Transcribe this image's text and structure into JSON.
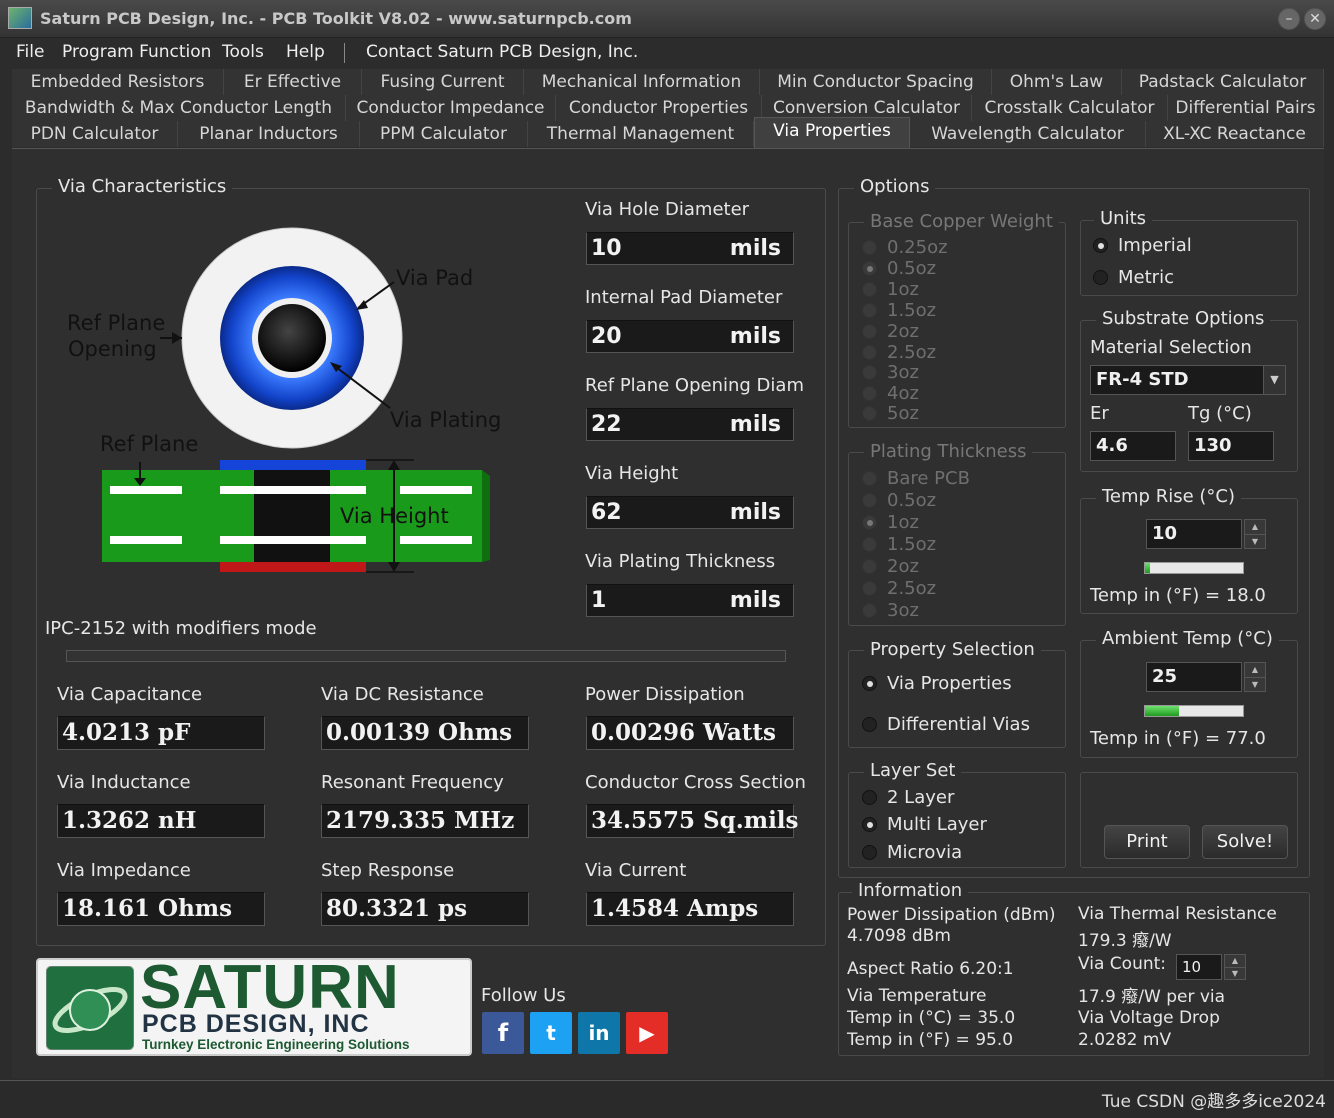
{
  "window": {
    "title": "Saturn PCB Design, Inc. - PCB Toolkit V8.02 - www.saturnpcb.com"
  },
  "menu": {
    "file": "File",
    "program_function": "Program Function",
    "tools": "Tools",
    "help": "Help",
    "contact": "Contact Saturn PCB Design, Inc."
  },
  "tabs": {
    "row1": [
      "Embedded Resistors",
      "Er Effective",
      "Fusing Current",
      "Mechanical Information",
      "Min Conductor Spacing",
      "Ohm's Law",
      "Padstack Calculator"
    ],
    "row2": [
      "Bandwidth & Max Conductor Length",
      "Conductor Impedance",
      "Conductor Properties",
      "Conversion Calculator",
      "Crosstalk Calculator",
      "Differential Pairs"
    ],
    "row3": [
      "PDN Calculator",
      "Planar Inductors",
      "PPM Calculator",
      "Thermal Management",
      "Via Properties",
      "Wavelength Calculator",
      "XL-XC Reactance"
    ],
    "active": "Via Properties"
  },
  "via_characteristics": {
    "title": "Via Characteristics",
    "diagram": {
      "via_pad": "Via Pad",
      "ref_plane_opening_1": "Ref Plane",
      "ref_plane_opening_2": "Opening",
      "via_plating": "Via Plating",
      "ref_plane": "Ref Plane",
      "via_height": "Via Height"
    },
    "inputs": {
      "hole_diameter": {
        "label": "Via Hole Diameter",
        "value": "10",
        "unit": "mils"
      },
      "internal_pad": {
        "label": "Internal Pad Diameter",
        "value": "20",
        "unit": "mils"
      },
      "ref_plane_opening": {
        "label": "Ref Plane Opening Diam",
        "value": "22",
        "unit": "mils"
      },
      "via_height": {
        "label": "Via Height",
        "value": "62",
        "unit": "mils"
      },
      "plating_thickness": {
        "label": "Via Plating Thickness",
        "value": "1",
        "unit": "mils"
      }
    },
    "mode": "IPC-2152 with modifiers mode",
    "results": {
      "capacitance": {
        "label": "Via Capacitance",
        "value": "4.0213 pF"
      },
      "dc_resistance": {
        "label": "Via DC Resistance",
        "value": "0.00139 Ohms"
      },
      "power_dissipation": {
        "label": "Power Dissipation",
        "value": "0.00296 Watts"
      },
      "inductance": {
        "label": "Via Inductance",
        "value": "1.3262 nH"
      },
      "resonant_frequency": {
        "label": "Resonant Frequency",
        "value": "2179.335 MHz"
      },
      "cross_section": {
        "label": "Conductor Cross Section",
        "value": "34.5575 Sq.mils"
      },
      "impedance": {
        "label": "Via Impedance",
        "value": "18.161 Ohms"
      },
      "step_response": {
        "label": "Step Response",
        "value": "80.3321 ps"
      },
      "via_current": {
        "label": "Via Current",
        "value": "1.4584 Amps"
      }
    }
  },
  "options": {
    "title": "Options",
    "base_copper": {
      "title": "Base Copper Weight",
      "items": [
        "0.25oz",
        "0.5oz",
        "1oz",
        "1.5oz",
        "2oz",
        "2.5oz",
        "3oz",
        "4oz",
        "5oz"
      ],
      "selected": "0.5oz"
    },
    "plating": {
      "title": "Plating Thickness",
      "items": [
        "Bare PCB",
        "0.5oz",
        "1oz",
        "1.5oz",
        "2oz",
        "2.5oz",
        "3oz"
      ],
      "selected": "1oz"
    },
    "units": {
      "title": "Units",
      "imperial": "Imperial",
      "metric": "Metric",
      "selected": "Imperial"
    },
    "substrate": {
      "title": "Substrate Options",
      "material_label": "Material Selection",
      "material": "FR-4 STD",
      "er_label": "Er",
      "er": "4.6",
      "tg_label": "Tg (°C)",
      "tg": "130"
    },
    "temp_rise": {
      "title": "Temp Rise (°C)",
      "value": "10",
      "level": 0.05,
      "readout": "Temp in (°F) = 18.0"
    },
    "ambient": {
      "title": "Ambient Temp (°C)",
      "value": "25",
      "level": 0.35,
      "readout": "Temp in (°F) = 77.0"
    },
    "property_selection": {
      "title": "Property Selection",
      "via_properties": "Via Properties",
      "differential_vias": "Differential Vias",
      "selected": "Via Properties"
    },
    "layer_set": {
      "title": "Layer Set",
      "items": [
        "2 Layer",
        "Multi Layer",
        "Microvia"
      ],
      "selected": "Multi Layer"
    },
    "print": "Print",
    "solve": "Solve!"
  },
  "information": {
    "title": "Information",
    "power_dissipation_label": "Power Dissipation (dBm)",
    "power_dissipation_value": "4.7098 dBm",
    "aspect_ratio": "Aspect Ratio   6.20:1",
    "via_temperature": "Via Temperature",
    "temp_c": "Temp in (°C) = 35.0",
    "temp_f": "Temp in (°F) = 95.0",
    "thermal_resistance_label": "Via Thermal Resistance",
    "thermal_resistance_value": "179.3 癈/W",
    "via_count_label": "Via Count:",
    "via_count": "10",
    "per_via": "17.9 癈/W per via",
    "voltage_drop_label": "Via Voltage Drop",
    "voltage_drop_value": "2.0282 mV"
  },
  "footer": {
    "logo_line1": "SATURN",
    "logo_line2": "PCB DESIGN, INC",
    "logo_tagline": "Turnkey Electronic Engineering Solutions",
    "follow_us": "Follow Us",
    "social": [
      "f",
      "t",
      "in",
      "▶"
    ]
  },
  "status": {
    "text": "Tue CSDN @趣多多ice2024"
  }
}
